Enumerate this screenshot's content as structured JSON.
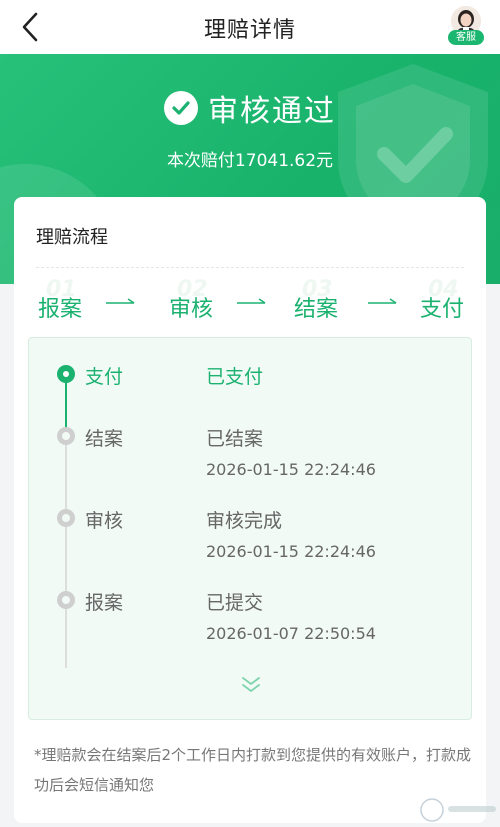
{
  "nav": {
    "title": "理赔详情",
    "back_icon": "chevron-left-icon",
    "customer_service_label": "客服"
  },
  "hero": {
    "status": "审核通过",
    "payout_text": "本次赔付17041.62元",
    "color_primary": "#1bb270"
  },
  "card": {
    "title": "理赔流程",
    "steps": [
      {
        "num": "01",
        "label": "报案"
      },
      {
        "num": "02",
        "label": "审核"
      },
      {
        "num": "03",
        "label": "结案"
      },
      {
        "num": "04",
        "label": "支付"
      }
    ],
    "timeline": [
      {
        "label": "支付",
        "status": "已支付",
        "time": "",
        "active": true
      },
      {
        "label": "结案",
        "status": "已结案",
        "time": "2026-01-15 22:24:46",
        "active": false
      },
      {
        "label": "审核",
        "status": "审核完成",
        "time": "2026-01-15 22:24:46",
        "active": false
      },
      {
        "label": "报案",
        "status": "已提交",
        "time": "2026-01-07 22:50:54",
        "active": false
      }
    ],
    "note": "*理赔款会在结案后2个工作日内打款到您提供的有效账户，打款成功后会短信通知您"
  }
}
